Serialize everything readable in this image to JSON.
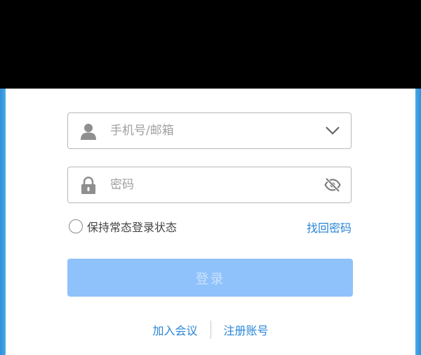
{
  "login": {
    "account_placeholder": "手机号/邮箱",
    "password_placeholder": "密码",
    "remember_label": "保持常态登录状态",
    "forgot_label": "找回密码",
    "login_label": "登录",
    "join_meeting_label": "加入会议",
    "register_label": "注册账号"
  },
  "icons": {
    "account": "user-icon",
    "dropdown": "chevron-down-icon",
    "password": "lock-icon",
    "visibility": "eye-off-icon"
  },
  "colors": {
    "link": "#2a86d6",
    "login_button": "#8fc2fb",
    "login_button_text": "#c9e2fd",
    "border": "#b8b8b8"
  }
}
